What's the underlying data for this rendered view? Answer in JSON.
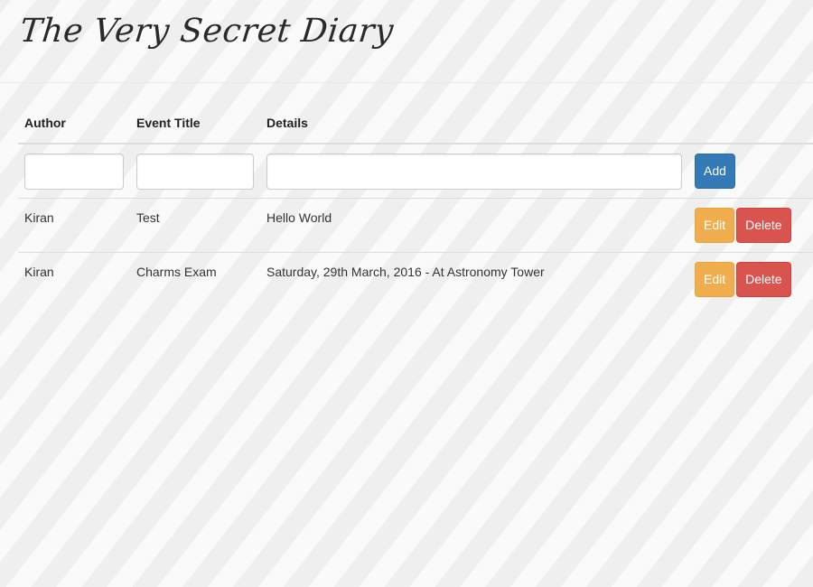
{
  "app": {
    "title": "The Very Secret Diary"
  },
  "table": {
    "headers": {
      "author": "Author",
      "event_title": "Event Title",
      "details": "Details"
    },
    "new_entry": {
      "author_value": "",
      "event_title_value": "",
      "details_value": "",
      "add_label": "Add"
    },
    "rows": [
      {
        "author": "Kiran",
        "event_title": "Test",
        "details": "Hello World",
        "edit_label": "Edit",
        "delete_label": "Delete"
      },
      {
        "author": "Kiran",
        "event_title": "Charms Exam",
        "details": "Saturday, 29th March, 2016 - At Astronomy Tower",
        "edit_label": "Edit",
        "delete_label": "Delete"
      }
    ]
  },
  "colors": {
    "add_button": "#337ab7",
    "edit_button": "#f0ad4e",
    "delete_button": "#d9534f"
  }
}
